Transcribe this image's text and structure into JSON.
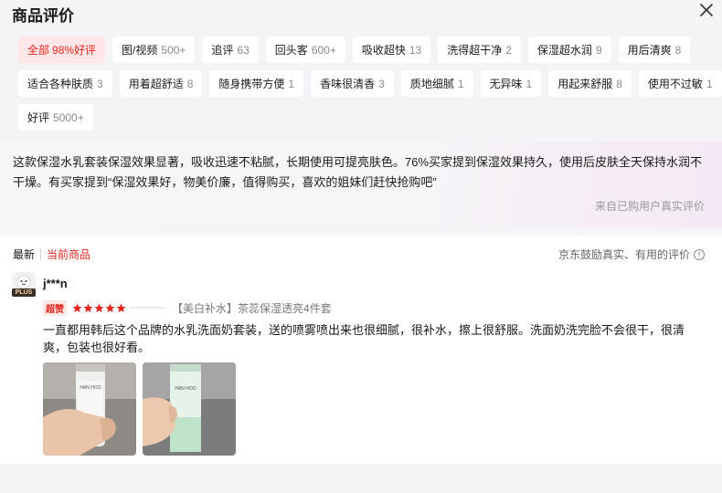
{
  "title": "商品评价",
  "tag_rows": [
    [
      {
        "label": "全部",
        "count": "98%好评",
        "active": true
      },
      {
        "label": "图/视频",
        "count": "500+"
      },
      {
        "label": "追评",
        "count": "63"
      },
      {
        "label": "回头客",
        "count": "600+"
      },
      {
        "label": "吸收超快",
        "count": "13"
      },
      {
        "label": "洗得超干净",
        "count": "2"
      },
      {
        "label": "保湿超水润",
        "count": "9"
      },
      {
        "label": "用后清爽",
        "count": "8"
      }
    ],
    [
      {
        "label": "适合各种肤质",
        "count": "3"
      },
      {
        "label": "用着超舒适",
        "count": "8"
      },
      {
        "label": "随身携带方便",
        "count": "1"
      },
      {
        "label": "香味很清香",
        "count": "3"
      },
      {
        "label": "质地细腻",
        "count": "1"
      },
      {
        "label": "无异味",
        "count": "1"
      },
      {
        "label": "用起来舒服",
        "count": "8"
      },
      {
        "label": "使用不过敏",
        "count": "1"
      }
    ],
    [
      {
        "label": "好评",
        "count": "5000+"
      }
    ]
  ],
  "summary": {
    "text": "这款保湿水乳套装保湿效果显著，吸收迅速不粘腻，长期使用可提亮肤色。76%买家提到保湿效果持久，使用后皮肤全天保持水润不干燥。有买家提到“保湿效果好，物美价廉，值得购买，喜欢的姐妹们赶快抢购吧”",
    "source": "来自已购用户真实评价"
  },
  "sort": {
    "latest": "最新",
    "current": "当前商品"
  },
  "policy_text": "京东鼓励真实、有用的评价",
  "review": {
    "username": "j***n",
    "plus_label": "PLUS",
    "badge": "超赞",
    "stars": 5,
    "variant": "【美白补水】茶蕊保湿透亮4件套",
    "text": "一直都用韩后这个品牌的水乳洗面奶套装，送的喷雾喷出来也很细腻，很补水，擦上很舒服。洗面奶洗完脸不会很干，很清爽，包装也很好看。",
    "photo_brand": "HAN HOO"
  },
  "colors": {
    "accent": "#e1251b",
    "active_tag_bg": "#ffe6e9",
    "tag_bg": "#ffffff",
    "page_bg": "#f5f5f7"
  },
  "icons": {
    "close": "close-icon",
    "info": "info-icon",
    "star": "star-icon",
    "avatar": "avatar"
  }
}
